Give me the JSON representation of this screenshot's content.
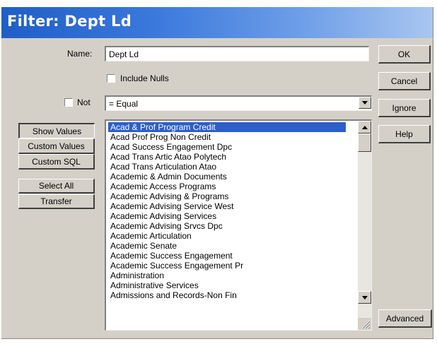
{
  "window": {
    "title": "Filter: Dept Ld"
  },
  "form": {
    "name_label": "Name:",
    "name_value": "Dept Ld",
    "include_nulls_label": "Include Nulls",
    "not_label": "Not",
    "operator_value": "= Equal"
  },
  "buttons": {
    "ok": "OK",
    "cancel": "Cancel",
    "ignore": "Ignore",
    "help": "Help",
    "advanced": "Advanced"
  },
  "side_buttons": {
    "show_values": "Show Values",
    "custom_values": "Custom Values",
    "custom_sql": "Custom SQL",
    "select_all": "Select All",
    "transfer": "Transfer"
  },
  "values_list": {
    "selected": "Acad & Prof Program Credit",
    "items": [
      "Acad & Prof Program Credit",
      "Acad Prof Prog Non Credit",
      "Acad Success Engagement Dpc",
      "Acad Trans Artic Atao Polytech",
      "Acad Trans Articulation Atao",
      "Academic & Admin Documents",
      "Academic Access Programs",
      "Academic Advising & Programs",
      "Academic Advising Service West",
      "Academic Advising Services",
      "Academic Advising Srvcs Dpc",
      "Academic Articulation",
      "Academic Senate",
      "Academic Success Engagement",
      "Academic Success Engagement Pr",
      "Administration",
      "Administrative Services",
      "Admissions and Records-Non Fin"
    ]
  },
  "icons": {
    "dropdown": "chevron-down-icon",
    "scroll_up": "arrow-up-icon",
    "scroll_down": "arrow-down-icon",
    "resize": "resize-grip-icon"
  },
  "colors": {
    "title_gradient_start": "#1f5ec6",
    "title_gradient_end": "#a9c6f0",
    "dialog_face": "#d4d0c8",
    "selection": "#2c5fc9"
  }
}
